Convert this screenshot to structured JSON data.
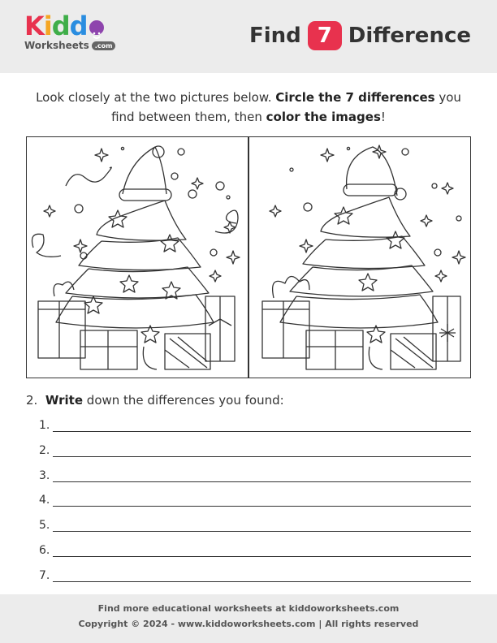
{
  "logo": {
    "word": "Kiddo",
    "sub": "Worksheets",
    "com": ".com"
  },
  "title": {
    "prefix": "Find",
    "number": "7",
    "suffix": "Difference"
  },
  "instructions": {
    "part1": "Look closely at the two pictures below. ",
    "bold1": "Circle the 7 differences",
    "part2": " you find between them, then ",
    "bold2": "color the images",
    "part3": "!"
  },
  "question2": {
    "number": "2.",
    "bold": "Write",
    "rest": " down the differences you found:"
  },
  "answer_lines": [
    "1.",
    "2.",
    "3.",
    "4.",
    "5.",
    "6.",
    "7."
  ],
  "footer": {
    "line1": "Find more educational worksheets at kiddoworksheets.com",
    "line2": "Copyright © 2024 - www.kiddoworksheets.com  |  All rights reserved"
  },
  "colors": {
    "accent": "#e8324e",
    "header_bg": "#ececec"
  },
  "images": [
    "christmas-tree-picture-left",
    "christmas-tree-picture-right"
  ]
}
